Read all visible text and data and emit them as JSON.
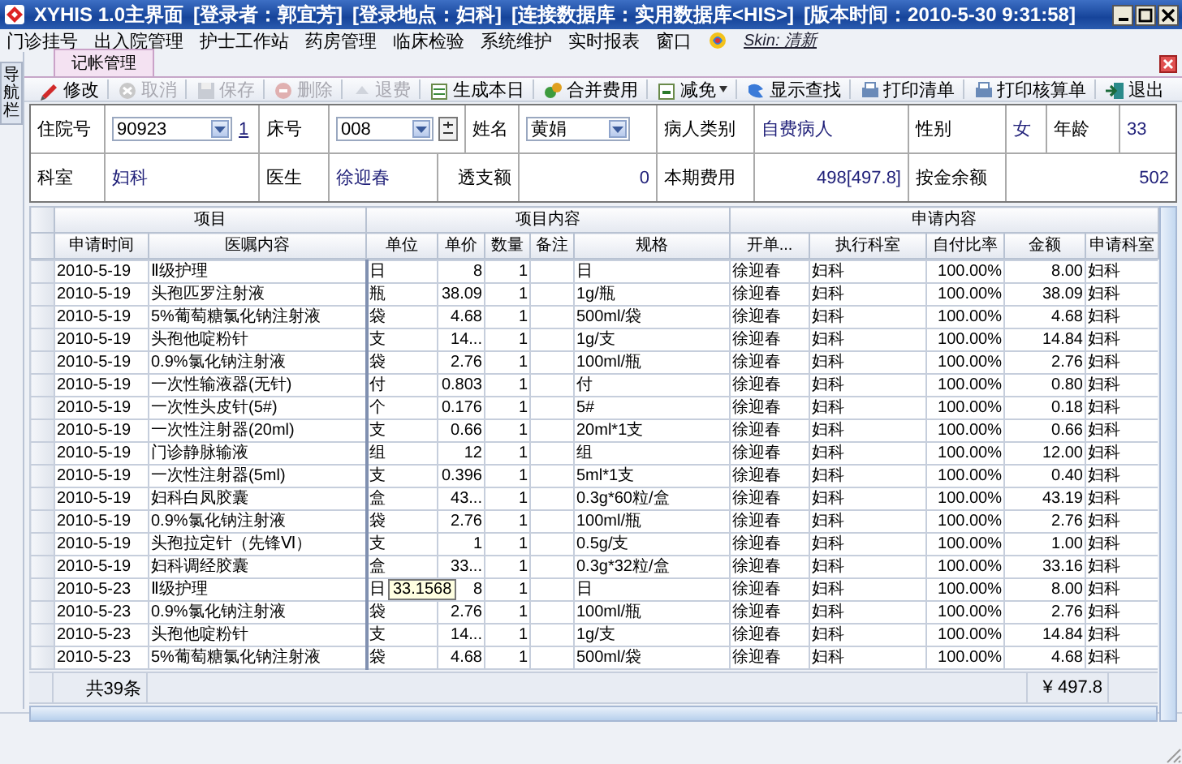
{
  "window": {
    "title": "XYHIS 1.0主界面",
    "info": [
      "[登录者：郭宜芳]",
      "[登录地点：妇科]",
      "[连接数据库：实用数据库<HIS>]",
      "[版本时间：2010-5-30 9:31:58]"
    ]
  },
  "menu": [
    "门诊挂号",
    "出入院管理",
    "护士工作站",
    "药房管理",
    "临床检验",
    "系统维护",
    "实时报表",
    "窗口"
  ],
  "skin": "Skin: 清新",
  "sidebar": {
    "label": "导航栏"
  },
  "tabs": [
    {
      "label": "记帐管理",
      "selected": true
    }
  ],
  "toolbar": [
    {
      "label": "修改",
      "kind": "edit",
      "disabled": false
    },
    {
      "label": "取消",
      "kind": "cancel",
      "disabled": true
    },
    {
      "label": "保存",
      "kind": "save",
      "disabled": true
    },
    {
      "label": "删除",
      "kind": "delete",
      "disabled": true
    },
    {
      "label": "退费",
      "kind": "refund",
      "disabled": true
    },
    {
      "label": "生成本日",
      "kind": "generate",
      "disabled": false
    },
    {
      "label": "合并费用",
      "kind": "merge",
      "disabled": false
    },
    {
      "label": "减免",
      "kind": "reduce",
      "disabled": false,
      "dropdown": true
    },
    {
      "label": "显示查找",
      "kind": "find",
      "disabled": false
    },
    {
      "label": "打印清单",
      "kind": "print",
      "disabled": false
    },
    {
      "label": "打印核算单",
      "kind": "print",
      "disabled": false
    },
    {
      "label": "退出",
      "kind": "exit",
      "disabled": false
    }
  ],
  "form": {
    "admission_no": {
      "label": "住院号",
      "value": "90923",
      "link": "1"
    },
    "bed": {
      "label": "床号",
      "value": "008"
    },
    "name": {
      "label": "姓名",
      "value": "黄娟"
    },
    "patient_type": {
      "label": "病人类别",
      "value": "自费病人"
    },
    "sex": {
      "label": "性别",
      "value": "女"
    },
    "age": {
      "label": "年龄",
      "value": "33"
    },
    "department": {
      "label": "科室",
      "value": "妇科"
    },
    "doctor": {
      "label": "医生",
      "value": "徐迎春"
    },
    "overdraft": {
      "label": "透支额",
      "value": "0"
    },
    "current_cost": {
      "label": "本期费用",
      "value": "498[497.8]"
    },
    "deposit_balance": {
      "label": "按金余额",
      "value": "502"
    }
  },
  "table": {
    "groups": [
      {
        "label": "项目",
        "columns": [
          "申请时间",
          "医嘱内容"
        ]
      },
      {
        "label": "项目内容",
        "columns": [
          "单位",
          "单价",
          "数量",
          "备注",
          "规格"
        ]
      },
      {
        "label": "申请内容",
        "columns": [
          "开单...",
          "执行科室",
          "自付比率",
          "金额",
          "申请科室"
        ]
      }
    ],
    "rows": [
      [
        "2010-5-19",
        "Ⅱ级护理",
        "日",
        "8",
        "1",
        "",
        "日",
        "徐迎春",
        "妇科",
        "100.00%",
        "8.00",
        "妇科"
      ],
      [
        "2010-5-19",
        "头孢匹罗注射液",
        "瓶",
        "38.09",
        "1",
        "",
        "1g/瓶",
        "徐迎春",
        "妇科",
        "100.00%",
        "38.09",
        "妇科"
      ],
      [
        "2010-5-19",
        "5%葡萄糖氯化钠注射液",
        "袋",
        "4.68",
        "1",
        "",
        "500ml/袋",
        "徐迎春",
        "妇科",
        "100.00%",
        "4.68",
        "妇科"
      ],
      [
        "2010-5-19",
        "头孢他啶粉针",
        "支",
        "14...",
        "1",
        "",
        "1g/支",
        "徐迎春",
        "妇科",
        "100.00%",
        "14.84",
        "妇科"
      ],
      [
        "2010-5-19",
        "0.9%氯化钠注射液",
        "袋",
        "2.76",
        "1",
        "",
        "100ml/瓶",
        "徐迎春",
        "妇科",
        "100.00%",
        "2.76",
        "妇科"
      ],
      [
        "2010-5-19",
        "一次性输液器(无针)",
        "付",
        "0.803",
        "1",
        "",
        "付",
        "徐迎春",
        "妇科",
        "100.00%",
        "0.80",
        "妇科"
      ],
      [
        "2010-5-19",
        "一次性头皮针(5#)",
        "个",
        "0.176",
        "1",
        "",
        "5#",
        "徐迎春",
        "妇科",
        "100.00%",
        "0.18",
        "妇科"
      ],
      [
        "2010-5-19",
        "一次性注射器(20ml)",
        "支",
        "0.66",
        "1",
        "",
        "20ml*1支",
        "徐迎春",
        "妇科",
        "100.00%",
        "0.66",
        "妇科"
      ],
      [
        "2010-5-19",
        "门诊静脉输液",
        "组",
        "12",
        "1",
        "",
        "组",
        "徐迎春",
        "妇科",
        "100.00%",
        "12.00",
        "妇科"
      ],
      [
        "2010-5-19",
        "一次性注射器(5ml)",
        "支",
        "0.396",
        "1",
        "",
        "5ml*1支",
        "徐迎春",
        "妇科",
        "100.00%",
        "0.40",
        "妇科"
      ],
      [
        "2010-5-19",
        "妇科白凤胶囊",
        "盒",
        "43...",
        "1",
        "",
        "0.3g*60粒/盒",
        "徐迎春",
        "妇科",
        "100.00%",
        "43.19",
        "妇科"
      ],
      [
        "2010-5-19",
        "0.9%氯化钠注射液",
        "袋",
        "2.76",
        "1",
        "",
        "100ml/瓶",
        "徐迎春",
        "妇科",
        "100.00%",
        "2.76",
        "妇科"
      ],
      [
        "2010-5-19",
        "头孢拉定针（先锋Ⅵ）",
        "支",
        "1",
        "1",
        "",
        "0.5g/支",
        "徐迎春",
        "妇科",
        "100.00%",
        "1.00",
        "妇科"
      ],
      [
        "2010-5-19",
        "妇科调经胶囊",
        "盒",
        "33...",
        "1",
        "",
        "0.3g*32粒/盒",
        "徐迎春",
        "妇科",
        "100.00%",
        "33.16",
        "妇科"
      ],
      [
        "2010-5-23",
        "Ⅱ级护理",
        "日",
        "8",
        "1",
        "",
        "日",
        "徐迎春",
        "妇科",
        "100.00%",
        "8.00",
        "妇科"
      ],
      [
        "2010-5-23",
        "0.9%氯化钠注射液",
        "袋",
        "2.76",
        "1",
        "",
        "100ml/瓶",
        "徐迎春",
        "妇科",
        "100.00%",
        "2.76",
        "妇科"
      ],
      [
        "2010-5-23",
        "头孢他啶粉针",
        "支",
        "14...",
        "1",
        "",
        "1g/支",
        "徐迎春",
        "妇科",
        "100.00%",
        "14.84",
        "妇科"
      ],
      [
        "2010-5-23",
        "5%葡萄糖氯化钠注射液",
        "袋",
        "4.68",
        "1",
        "",
        "500ml/袋",
        "徐迎春",
        "妇科",
        "100.00%",
        "4.68",
        "妇科"
      ]
    ],
    "tooltip": "33.1568",
    "footer": {
      "count": "共39条",
      "total": "¥ 497.8"
    }
  }
}
